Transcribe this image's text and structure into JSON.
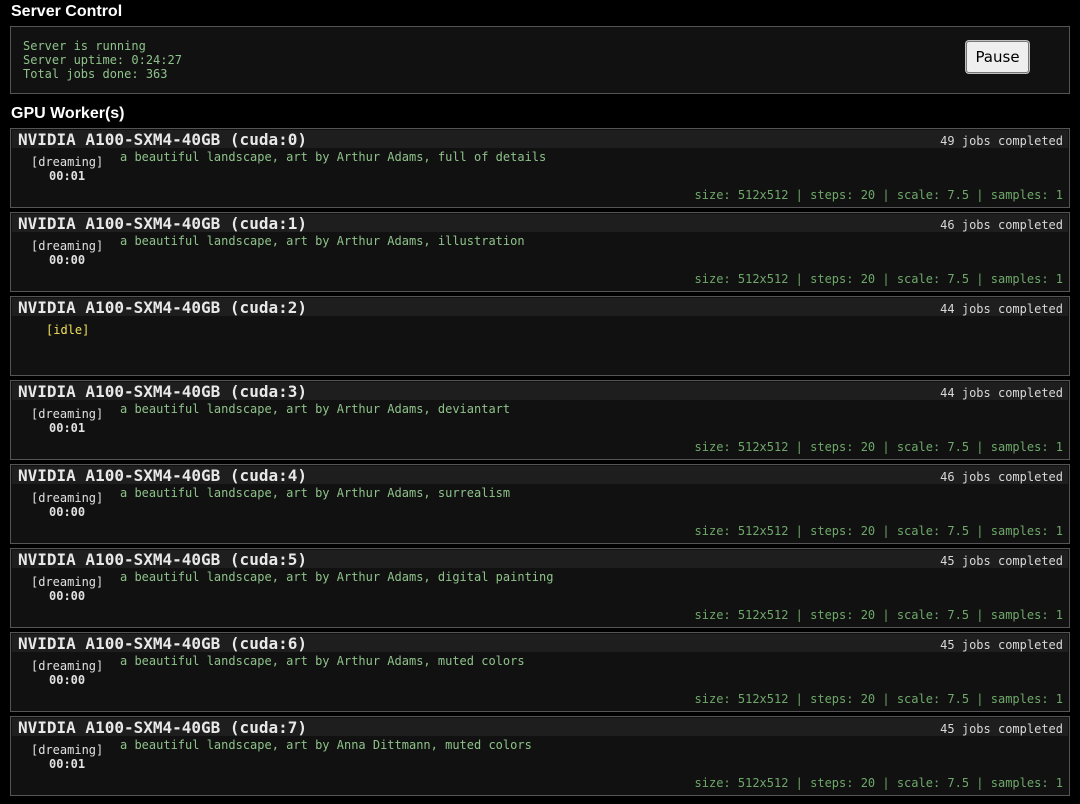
{
  "server_control": {
    "title": "Server Control",
    "status_lines": [
      "Server is running",
      "Server uptime: 0:24:27",
      "Total jobs done: 363"
    ],
    "pause_label": "Pause"
  },
  "gpu_workers": {
    "title": "GPU Worker(s)",
    "workers": [
      {
        "name": "NVIDIA A100-SXM4-40GB (cuda:0)",
        "jobs": "49 jobs completed",
        "state": "[dreaming]",
        "time": "00:01",
        "prompt": "a beautiful landscape, art by Arthur Adams, full of details",
        "params": "size: 512x512 | steps: 20 | scale: 7.5 | samples: 1"
      },
      {
        "name": "NVIDIA A100-SXM4-40GB (cuda:1)",
        "jobs": "46 jobs completed",
        "state": "[dreaming]",
        "time": "00:00",
        "prompt": "a beautiful landscape, art by Arthur Adams, illustration",
        "params": "size: 512x512 | steps: 20 | scale: 7.5 | samples: 1"
      },
      {
        "name": "NVIDIA A100-SXM4-40GB (cuda:2)",
        "jobs": "44 jobs completed",
        "state": "[idle]",
        "time": "",
        "prompt": "",
        "params": ""
      },
      {
        "name": "NVIDIA A100-SXM4-40GB (cuda:3)",
        "jobs": "44 jobs completed",
        "state": "[dreaming]",
        "time": "00:01",
        "prompt": "a beautiful landscape, art by Arthur Adams, deviantart",
        "params": "size: 512x512 | steps: 20 | scale: 7.5 | samples: 1"
      },
      {
        "name": "NVIDIA A100-SXM4-40GB (cuda:4)",
        "jobs": "46 jobs completed",
        "state": "[dreaming]",
        "time": "00:00",
        "prompt": "a beautiful landscape, art by Arthur Adams, surrealism",
        "params": "size: 512x512 | steps: 20 | scale: 7.5 | samples: 1"
      },
      {
        "name": "NVIDIA A100-SXM4-40GB (cuda:5)",
        "jobs": "45 jobs completed",
        "state": "[dreaming]",
        "time": "00:00",
        "prompt": "a beautiful landscape, art by Arthur Adams, digital painting",
        "params": "size: 512x512 | steps: 20 | scale: 7.5 | samples: 1"
      },
      {
        "name": "NVIDIA A100-SXM4-40GB (cuda:6)",
        "jobs": "45 jobs completed",
        "state": "[dreaming]",
        "time": "00:00",
        "prompt": "a beautiful landscape, art by Arthur Adams, muted colors",
        "params": "size: 512x512 | steps: 20 | scale: 7.5 | samples: 1"
      },
      {
        "name": "NVIDIA A100-SXM4-40GB (cuda:7)",
        "jobs": "45 jobs completed",
        "state": "[dreaming]",
        "time": "00:01",
        "prompt": "a beautiful landscape, art by Anna Dittmann, muted colors",
        "params": "size: 512x512 | steps: 20 | scale: 7.5 | samples: 1"
      }
    ]
  }
}
